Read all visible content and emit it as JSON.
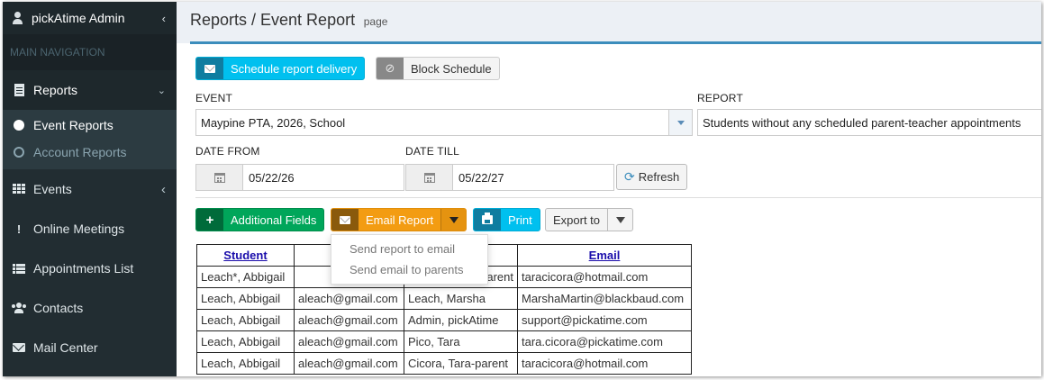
{
  "sidebar": {
    "user": "pickAtime Admin",
    "header": "MAIN NAVIGATION",
    "items": [
      {
        "label": "Reports"
      },
      {
        "label": "Events"
      },
      {
        "label": "Online Meetings"
      },
      {
        "label": "Appointments List"
      },
      {
        "label": "Contacts"
      },
      {
        "label": "Mail Center"
      }
    ],
    "subitems": [
      {
        "label": "Event Reports"
      },
      {
        "label": "Account Reports"
      }
    ]
  },
  "header": {
    "title": "Reports / Event Report",
    "subtitle": "page"
  },
  "toolbar": {
    "schedule_label": "Schedule report delivery",
    "block_label": "Block Schedule"
  },
  "filters": {
    "event_label": "EVENT",
    "event_value": "Maypine PTA, 2026, School",
    "report_label": "REPORT",
    "report_value": "Students without any scheduled parent-teacher appointments",
    "date_from_label": "DATE FROM",
    "date_from_value": "05/22/26",
    "date_till_label": "DATE TILL",
    "date_till_value": "05/22/27",
    "refresh_label": "Refresh"
  },
  "actions": {
    "additional_fields": "Additional Fields",
    "email_report": "Email Report",
    "print": "Print",
    "export_to": "Export to"
  },
  "email_menu": [
    "Send report to email",
    "Send email to parents"
  ],
  "table": {
    "headers": [
      "Student",
      "",
      "",
      "Email"
    ],
    "rows": [
      [
        "Leach*, Abbigail",
        "",
        "-parent",
        "taracicora@hotmail.com"
      ],
      [
        "Leach, Abbigail",
        "aleach@gmail.com",
        "Leach, Marsha",
        "MarshaMartin@blackbaud.com"
      ],
      [
        "Leach, Abbigail",
        "aleach@gmail.com",
        "Admin, pickAtime",
        "support@pickatime.com"
      ],
      [
        "Leach, Abbigail",
        "aleach@gmail.com",
        "Pico, Tara",
        "tara.cicora@pickatime.com"
      ],
      [
        "Leach, Abbigail",
        "aleach@gmail.com",
        "Cicora, Tara-parent",
        "taracicora@hotmail.com"
      ]
    ]
  },
  "colors": {
    "sidebar_bg": "#222d32",
    "accent": "#3c8dbc",
    "info": "#00c0ef",
    "success": "#00a65a",
    "warning": "#f39c12"
  },
  "icons": [
    "user-icon",
    "file-icon",
    "th-icon",
    "exclamation-icon",
    "list-icon",
    "users-icon",
    "envelope-icon",
    "calendar-icon",
    "refresh-icon",
    "plus-icon",
    "print-icon",
    "ban-icon"
  ]
}
